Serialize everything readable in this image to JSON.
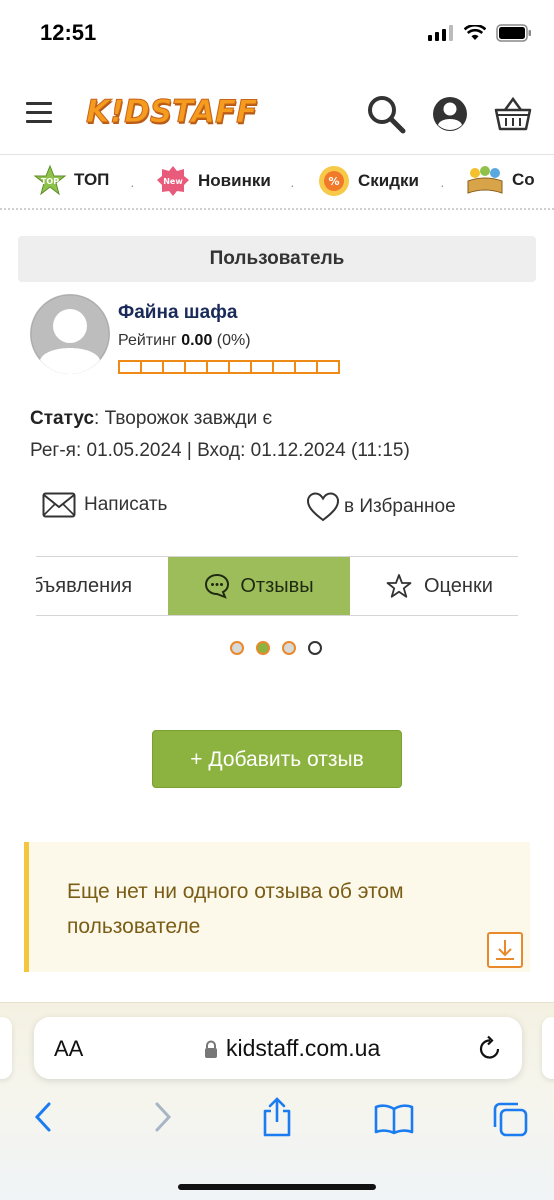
{
  "status_bar": {
    "time": "12:51"
  },
  "header": {
    "logo_text": "K!DSTAFF"
  },
  "categories": [
    {
      "label": "ТОП",
      "icon": "top-star-icon"
    },
    {
      "label": "Новинки",
      "icon": "new-badge-icon"
    },
    {
      "label": "Скидки",
      "icon": "discount-icon"
    },
    {
      "label": "Со",
      "icon": "books-icon"
    }
  ],
  "panel": {
    "title": "Пользователь",
    "user_name": "Файна шафа",
    "rating_label": "Рейтинг",
    "rating_value": "0.00",
    "rating_percent": "(0%)",
    "rating_fill": 0,
    "status_label": "Статус",
    "status_value": ": Творожок завжди є",
    "reg_line": "Рег-я: 01.05.2024 | Вход: 01.12.2024 (11:15)",
    "write_label": "Написать",
    "favorite_label": "в Избранное"
  },
  "tabs": {
    "ads": "бъявления",
    "reviews": "Отзывы",
    "ratings": "Оценки",
    "active": "reviews"
  },
  "pager": {
    "count": 4,
    "active_index": 1
  },
  "add_review_label": "+ Добавить отзыв",
  "notice_text": "Еще нет ни одного отзыва об этом пользователе",
  "browser": {
    "aa_label": "AA",
    "url": "kidstaff.com.ua"
  },
  "colors": {
    "accent_green": "#8cb33f",
    "tab_active": "#9cbd5a",
    "rating_orange": "#f08a16",
    "notice_bg": "#fdf9ea",
    "notice_border": "#f3c63d",
    "notice_text": "#7a5d16",
    "ios_blue": "#1a7cf0"
  }
}
